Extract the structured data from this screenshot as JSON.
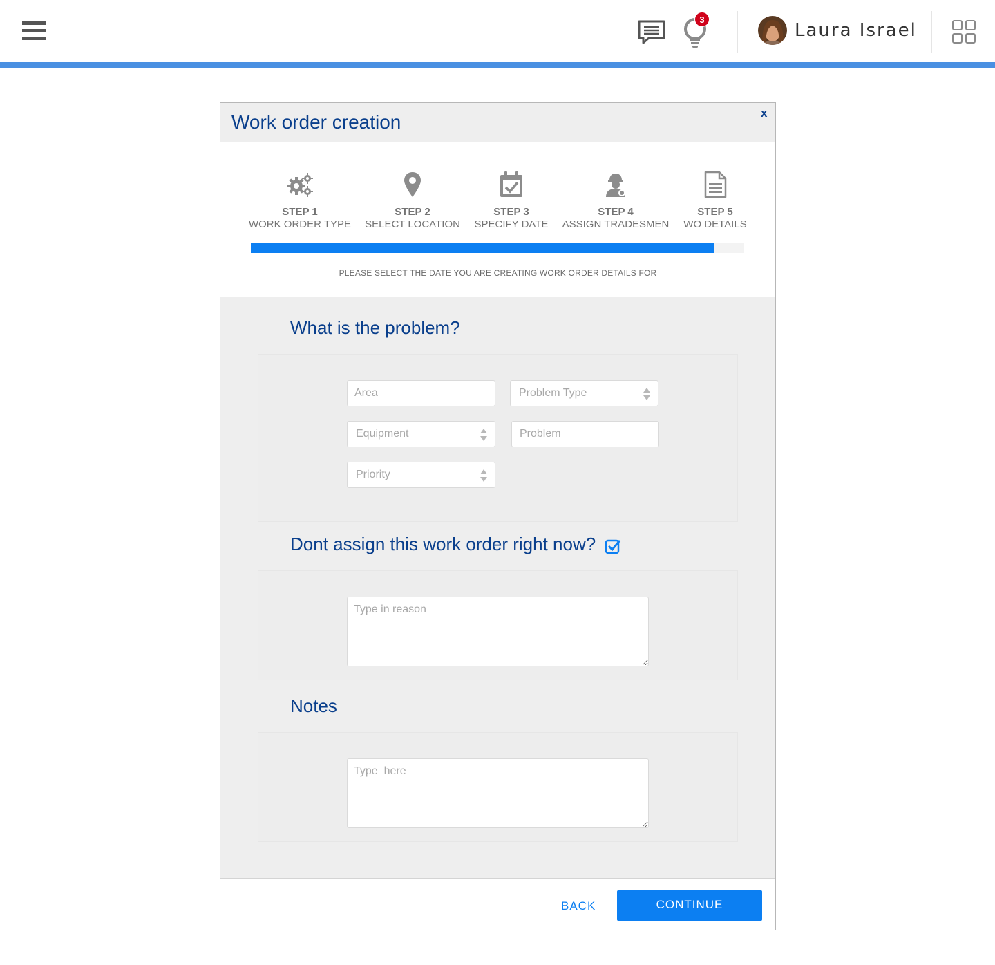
{
  "header": {
    "notification_count": "3",
    "user_name": "Laura Israel"
  },
  "modal": {
    "title": "Work order creation",
    "close_label": "x",
    "steps": [
      {
        "number": "STEP 1",
        "label": "WORK ORDER TYPE",
        "icon": "gears-icon"
      },
      {
        "number": "STEP 2",
        "label": "SELECT LOCATION",
        "icon": "map-pin-icon"
      },
      {
        "number": "STEP 3",
        "label": "SPECIFY DATE",
        "icon": "calendar-check-icon"
      },
      {
        "number": "STEP 4",
        "label": "ASSIGN TRADESMEN",
        "icon": "worker-icon"
      },
      {
        "number": "STEP 5",
        "label": "WO DETAILS",
        "icon": "document-icon"
      }
    ],
    "progress_fraction": 0.94,
    "instruction": "PLEASE SELECT THE DATE YOU ARE CREATING WORK ORDER DETAILS FOR",
    "problem_section": {
      "title": "What is the problem?",
      "area_placeholder": "Area",
      "problem_type_placeholder": "Problem Type",
      "equipment_placeholder": "Equipment",
      "problem_placeholder": "Problem",
      "priority_placeholder": "Priority"
    },
    "assign_section": {
      "title": "Dont assign this work order right now?",
      "checked": true,
      "reason_placeholder": "Type in reason"
    },
    "notes_section": {
      "title": "Notes",
      "notes_placeholder": "Type  here"
    },
    "footer": {
      "back_label": "BACK",
      "continue_label": "CONTINUE"
    }
  },
  "colors": {
    "accent": "#0c7ff2",
    "title": "#0a3f8c",
    "topbar_line": "#4a90e2",
    "badge": "#d0021b"
  }
}
